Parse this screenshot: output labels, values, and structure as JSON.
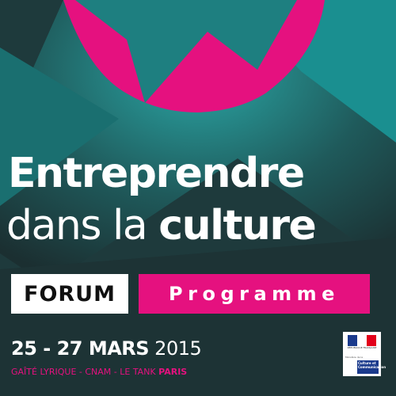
{
  "title": {
    "line1": "Entreprendre",
    "line2_light": "dans la ",
    "line2_bold": "culture"
  },
  "forum_label": "FORUM",
  "programme_label": "Programme",
  "dates": {
    "bold": "25 - 27 MARS",
    "normal": " 2015"
  },
  "venues": {
    "list": "GAÎTÉ LYRIQUE - CNAM - LE TANK ",
    "city": "PARIS"
  },
  "logo": {
    "republic_text": "RÉPUBLIQUE FRANÇAISE",
    "ministere_text": "Ministère de la",
    "culture_text": "Culture et Communication"
  },
  "colors": {
    "magenta": "#e5117f",
    "teal": "#1aa8a8",
    "dark_green": "#1f3a3c",
    "white": "#ffffff",
    "flag_blue": "#1a3a8c",
    "flag_red": "#e2001a"
  }
}
